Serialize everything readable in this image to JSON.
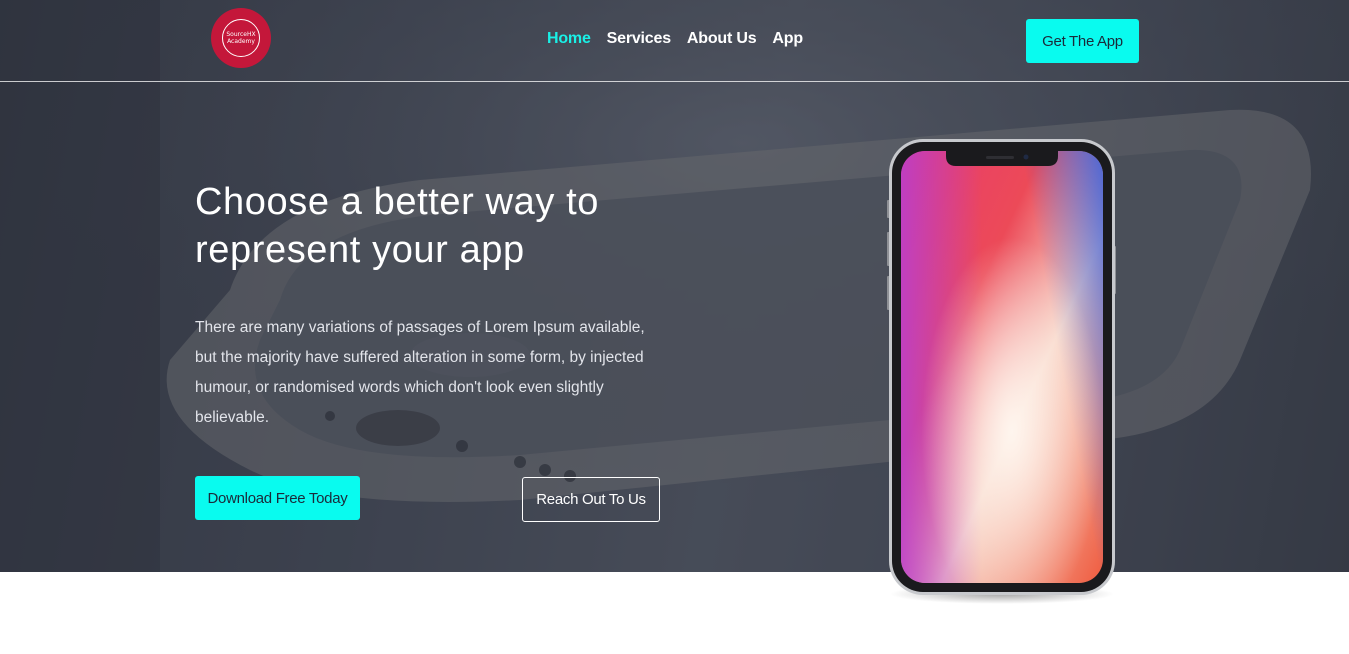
{
  "brand": {
    "logo_line1": "SourceHX",
    "logo_line2": "Academy"
  },
  "nav": {
    "items": [
      {
        "label": "Home",
        "active": true
      },
      {
        "label": "Services",
        "active": false
      },
      {
        "label": "About Us",
        "active": false
      },
      {
        "label": "App",
        "active": false
      }
    ],
    "cta_label": "Get The App"
  },
  "hero": {
    "headline_line1": "Choose a better way to",
    "headline_line2": "represent your app",
    "description": "There are many variations of passages of Lorem Ipsum available, but the majority have suffered alteration in some form, by injected humour, or randomised words which don't look even slightly believable.",
    "primary_button": "Download Free Today",
    "secondary_button": "Reach Out To Us"
  },
  "colors": {
    "accent": "#09fbef",
    "active_nav": "#19f0e6",
    "logo_bg": "#c4173a",
    "hero_bg": "#4a4f5d"
  },
  "icons": {
    "logo": "brand-logo-icon",
    "phone": "smartphone-mockup-image"
  }
}
